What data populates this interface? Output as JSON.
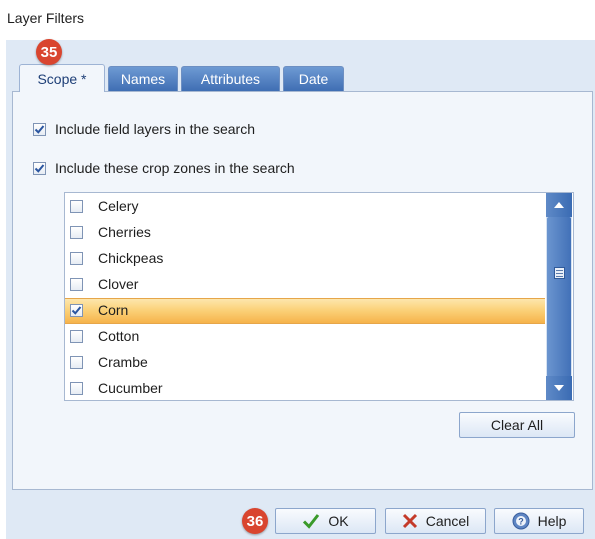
{
  "window": {
    "title": "Layer Filters"
  },
  "annotations": {
    "tabs_badge": "35",
    "buttons_badge": "36"
  },
  "tabs": [
    {
      "label": "Scope *",
      "active": true
    },
    {
      "label": "Names",
      "active": false
    },
    {
      "label": "Attributes",
      "active": false
    },
    {
      "label": "Date",
      "active": false
    }
  ],
  "options": {
    "field_layers": {
      "label": "Include field layers in the search",
      "checked": true
    },
    "crop_zones": {
      "label": "Include these crop zones in the search",
      "checked": true
    }
  },
  "crops": [
    {
      "label": "Celery",
      "checked": false,
      "selected": false
    },
    {
      "label": "Cherries",
      "checked": false,
      "selected": false
    },
    {
      "label": "Chickpeas",
      "checked": false,
      "selected": false
    },
    {
      "label": "Clover",
      "checked": false,
      "selected": false
    },
    {
      "label": "Corn",
      "checked": true,
      "selected": true
    },
    {
      "label": "Cotton",
      "checked": false,
      "selected": false
    },
    {
      "label": "Crambe",
      "checked": false,
      "selected": false
    },
    {
      "label": "Cucumber",
      "checked": false,
      "selected": false
    }
  ],
  "buttons": {
    "clear_all": "Clear All",
    "ok": "OK",
    "cancel": "Cancel",
    "help": "Help"
  },
  "colors": {
    "badge": "#d9452f",
    "selection": "#fbd27a",
    "tab_inactive": "#3f6eb3"
  },
  "icons": {
    "ok": "checkmark-icon",
    "cancel": "x-icon",
    "help": "help-icon"
  }
}
